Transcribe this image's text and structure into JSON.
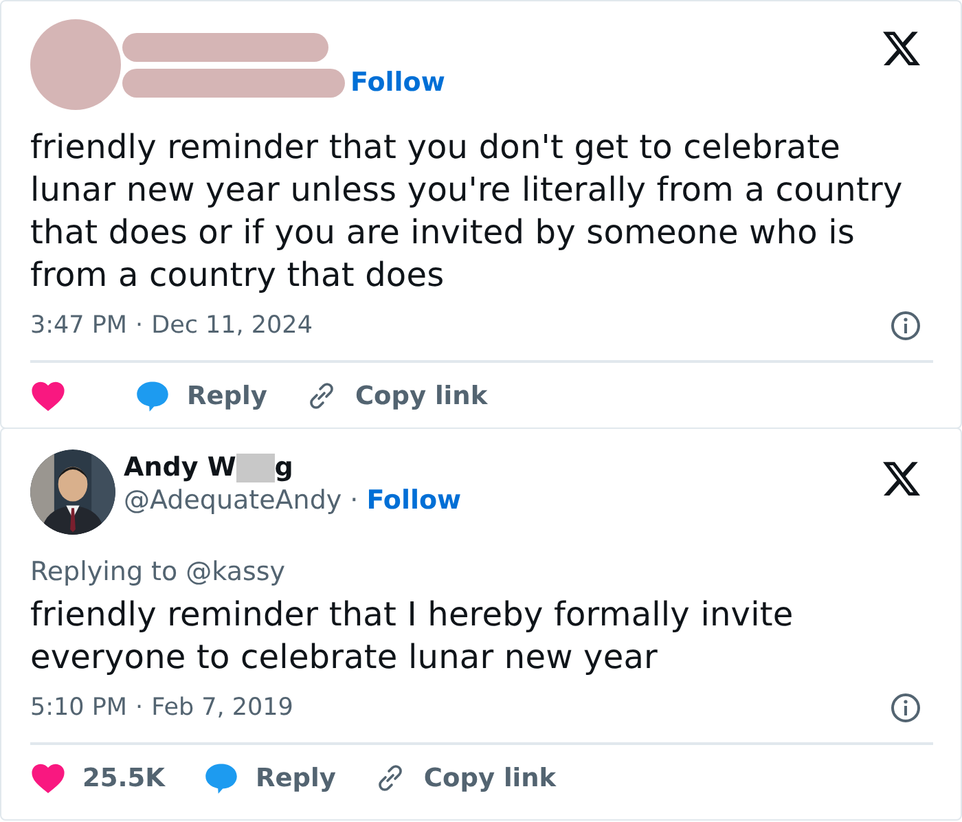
{
  "tweets": [
    {
      "author": {
        "kind": "redacted",
        "follow": "Follow"
      },
      "text": "friendly reminder that you don't get to celebrate lunar new year unless you're literally from a country that does or if you are invited by someone who is from a country that does",
      "time": "3:47 PM",
      "dot": "·",
      "date": "Dec 11, 2024",
      "liked": true,
      "reply": "Reply",
      "copy": "Copy link"
    },
    {
      "author": {
        "kind": "named",
        "name_start": "Andy W",
        "name_end": "g",
        "handle": "@AdequateAndy",
        "dot": "·",
        "follow": "Follow"
      },
      "replying": "Replying to @kassy",
      "text": "friendly reminder that I hereby formally invite everyone to celebrate lunar new year",
      "time": "5:10 PM",
      "dot": "·",
      "date": "Feb 7, 2019",
      "liked": true,
      "likes": "25.5K",
      "reply": "Reply",
      "copy": "Copy link"
    }
  ]
}
